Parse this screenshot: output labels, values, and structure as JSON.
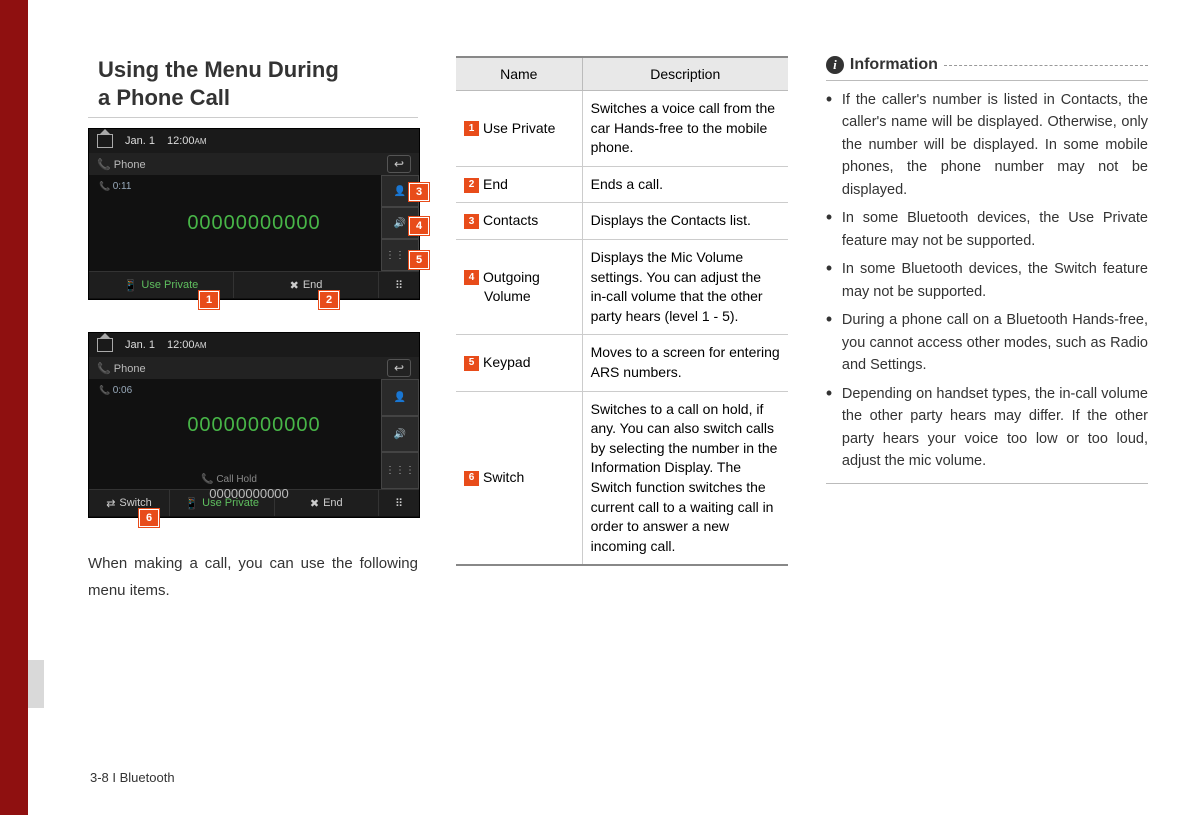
{
  "section_title_l1": "Using the Menu During",
  "section_title_l2": "a Phone Call",
  "screenshot1": {
    "date": "Jan. 1",
    "time": "12:00",
    "ampm": "AM",
    "crumb": "Phone",
    "timer": "0:11",
    "number": "00000000000",
    "btn_private": "Use Private",
    "btn_end": "End"
  },
  "screenshot2": {
    "date": "Jan. 1",
    "time": "12:00",
    "ampm": "AM",
    "crumb": "Phone",
    "timer": "0:06",
    "number": "00000000000",
    "hold_label": "Call Hold",
    "hold_number": "00000000000",
    "btn_switch": "Switch",
    "btn_private": "Use Private",
    "btn_end": "End"
  },
  "body_text": "When making a call, you can use the following menu items.",
  "table": {
    "head_name": "Name",
    "head_desc": "Description",
    "rows": [
      {
        "n": "1",
        "name": "Use Private",
        "desc": "Switches a voice call from the car Hands-free to the mobile phone."
      },
      {
        "n": "2",
        "name": "End",
        "desc": "Ends a call."
      },
      {
        "n": "3",
        "name": "Contacts",
        "desc": "Displays the Contacts list."
      },
      {
        "n": "4",
        "name": "Outgoing",
        "name2": "Volume",
        "desc": "Displays the Mic Volume settings. You can adjust the in-call volume that the other party hears (level 1 - 5)."
      },
      {
        "n": "5",
        "name": "Keypad",
        "desc": "Moves to a screen for entering ARS numbers."
      },
      {
        "n": "6",
        "name": "Switch",
        "desc": "Switches to a call on hold, if any. You can also switch calls by selecting the number in the Information Display. The Switch function switches the current call to a waiting call in order to answer a new incoming call."
      }
    ]
  },
  "info": {
    "title": "Information",
    "items": [
      "If the caller's number is listed in Contacts, the caller's name will be displayed. Otherwise, only the number will be displayed. In some mobile phones, the phone number may not be displayed.",
      "In some Bluetooth devices, the Use Private feature may not be supported.",
      "In some Bluetooth devices, the Switch feature may not be supported.",
      "During a phone call on a Bluetooth Hands-free, you cannot access other modes, such as Radio and Settings.",
      "Depending on handset types, the in-call volume the other party hears may differ. If the other party hears your voice too low or too loud, adjust the mic volume."
    ]
  },
  "footer": "3-8 I Bluetooth",
  "callouts": {
    "c1": "1",
    "c2": "2",
    "c3": "3",
    "c4": "4",
    "c5": "5",
    "c6": "6"
  }
}
